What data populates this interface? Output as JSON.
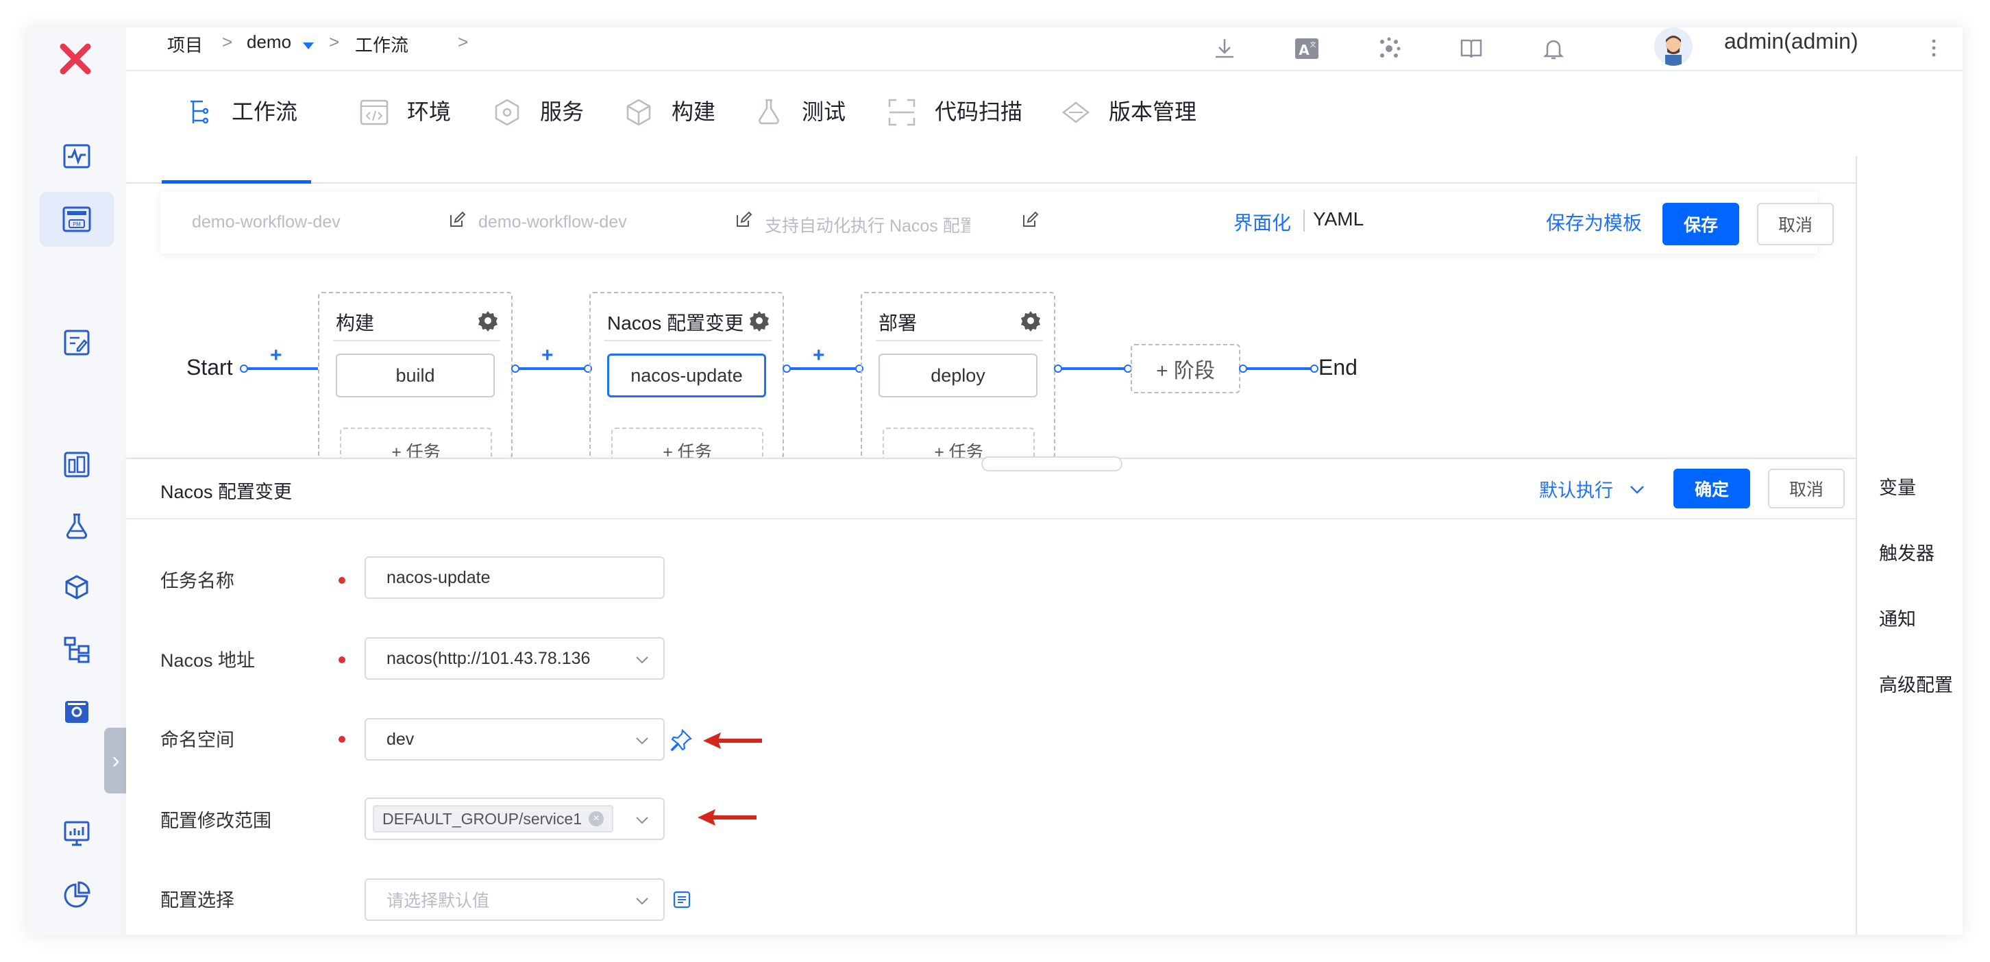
{
  "breadcrumb": {
    "project": "项目",
    "sep": ">",
    "demo": "demo",
    "workflow": "工作流"
  },
  "user": {
    "name": "admin(admin)"
  },
  "tabs": [
    {
      "label": "工作流",
      "icon": "workflow-icon",
      "active": true
    },
    {
      "label": "环境",
      "icon": "environment-icon"
    },
    {
      "label": "服务",
      "icon": "service-icon"
    },
    {
      "label": "构建",
      "icon": "build-icon"
    },
    {
      "label": "测试",
      "icon": "test-flask-icon"
    },
    {
      "label": "代码扫描",
      "icon": "scan-icon"
    },
    {
      "label": "版本管理",
      "icon": "version-icon"
    }
  ],
  "editor": {
    "name1": "demo-workflow-dev",
    "name2": "demo-workflow-dev",
    "desc": "支持自动化执行 Nacos 配置",
    "mode_ui": "界面化",
    "mode_yaml": "YAML",
    "save_template": "保存为模板",
    "save": "保存",
    "cancel": "取消"
  },
  "workflow": {
    "start": "Start",
    "end": "End",
    "plus": "+",
    "add_stage": "+ 阶段",
    "add_task": "+ 任务",
    "stages": [
      {
        "title": "构建",
        "job": "build"
      },
      {
        "title": "Nacos 配置变更",
        "job": "nacos-update",
        "active": true
      },
      {
        "title": "部署",
        "job": "deploy"
      }
    ]
  },
  "panel": {
    "title": "Nacos 配置变更",
    "run_mode": "默认执行",
    "confirm": "确定",
    "cancel": "取消",
    "fields": {
      "task_name_label": "任务名称",
      "task_name_value": "nacos-update",
      "nacos_addr_label": "Nacos 地址",
      "nacos_addr_value": "nacos(http://101.43.78.136",
      "namespace_label": "命名空间",
      "namespace_value": "dev",
      "range_label": "配置修改范围",
      "range_tag": "DEFAULT_GROUP/service1",
      "config_select_label": "配置选择",
      "config_select_placeholder": "请选择默认值"
    }
  },
  "right_panel": {
    "items": [
      "变量",
      "触发器",
      "通知",
      "高级配置"
    ]
  },
  "colors": {
    "accent": "#0066ff",
    "logo": "#e8384f",
    "arrow": "#d7261e"
  }
}
